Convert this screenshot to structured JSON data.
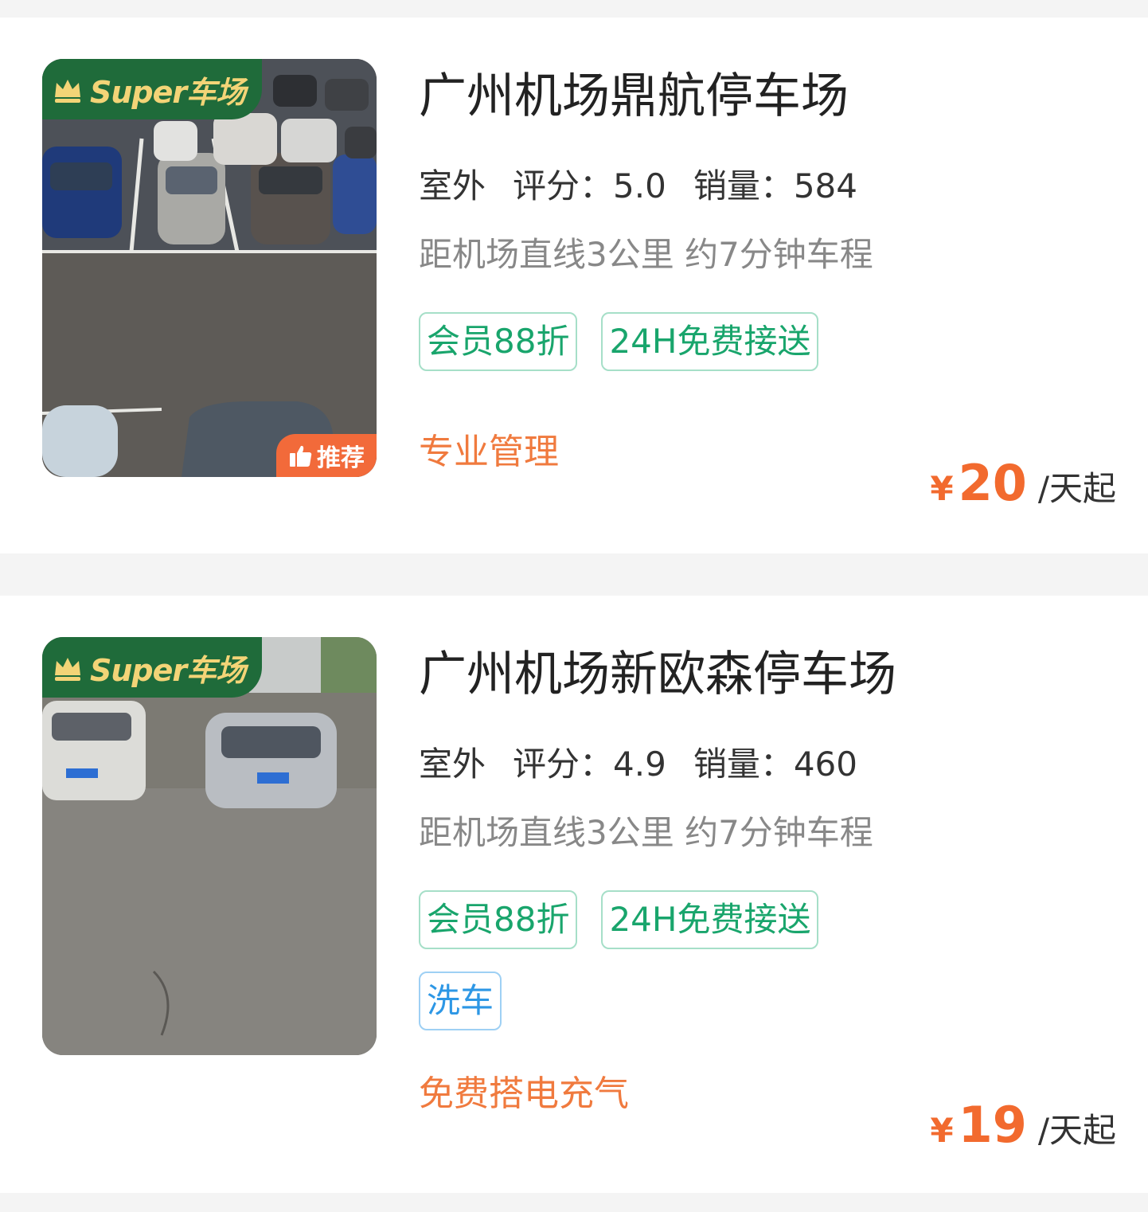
{
  "listings": [
    {
      "badge": "Super车场",
      "recommend": "推荐",
      "title": "广州机场鼎航停车场",
      "type": "室外",
      "rating": "评分：5.0",
      "sales": "销量：584",
      "distance": "距机场直线3公里 约7分钟车程",
      "tags": [
        "会员88折",
        "24H免费接送"
      ],
      "extra_tags": [],
      "feature": "专业管理",
      "currency": "¥",
      "price": "20",
      "price_unit": "/天起"
    },
    {
      "badge": "Super车场",
      "title": "广州机场新欧森停车场",
      "type": "室外",
      "rating": "评分：4.9",
      "sales": "销量：460",
      "distance": "距机场直线3公里 约7分钟车程",
      "tags": [
        "会员88折",
        "24H免费接送"
      ],
      "extra_tags": [
        "洗车"
      ],
      "feature": "免费搭电充气",
      "currency": "¥",
      "price": "19",
      "price_unit": "/天起"
    }
  ],
  "colors": {
    "badge_green": "#1f6b3a",
    "badge_gold": "#f3d477",
    "tag_green": "#19a56c",
    "tag_blue": "#2d97e5",
    "accent_orange": "#f26a2e"
  },
  "icons": {
    "crown": "crown-icon",
    "thumbs_up": "thumbs-up-icon"
  }
}
